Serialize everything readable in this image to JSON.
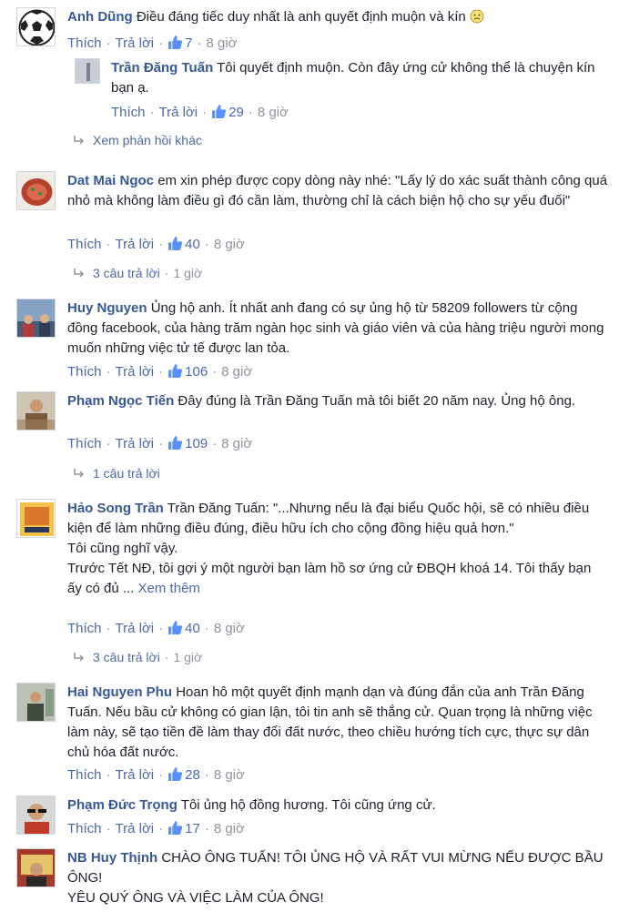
{
  "common": {
    "like_label": "Thích",
    "reply_label": "Trả lời",
    "sep": "·"
  },
  "comments": [
    {
      "name": "Anh Dũng",
      "text": "Điều đáng tiếc duy nhất là anh quyết định muộn và kín",
      "likes": "7",
      "time": "8 giờ",
      "avatar_color": "#222222",
      "reply": {
        "name": "Trần Đăng Tuấn",
        "text": "Tôi quyết định muộn. Còn đây ứng cử không thể là chuyện kín bạn ạ.",
        "likes": "29",
        "time": "8 giờ"
      },
      "more_replies": "Xem phản hồi khác"
    },
    {
      "name": "Dat Mai Ngoc",
      "text": "em xin phép được copy dòng này nhé: \"Lấy lý do xác suất thành công quá nhỏ mà không làm điều gì đó cần làm, thường chỉ là cách biện hộ cho sự yếu đuối\"",
      "likes": "40",
      "time": "8 giờ",
      "avatar_color": "#b5412f",
      "replies_count": "3 câu trả lời",
      "replies_time": "1 giờ"
    },
    {
      "name": "Huy Nguyen",
      "text": "Ủng hộ anh. Ít nhất anh đang có sự ủng hộ từ 58209 followers từ cộng đồng facebook, của hàng trăm ngàn học sinh và giáo viên và của hàng triệu người mong muốn những việc tử tế được lan tỏa.",
      "likes": "106",
      "time": "8 giờ",
      "avatar_color": "#6b7f9a"
    },
    {
      "name": "Phạm Ngọc Tiến",
      "text": "Đây đúng là Trần Đăng Tuấn mà tôi biết 20 năm nay. Ủng hộ ông.",
      "likes": "109",
      "time": "8 giờ",
      "avatar_color": "#8a6a4a",
      "replies_count": "1 câu trả lời"
    },
    {
      "name": "Hảo Song Trần",
      "text": "Trần Đăng Tuấn: \"...Nhưng nếu là đại biểu Quốc hội, sẽ có nhiều điều kiện để làm những điều đúng, điều hữu ích cho cộng đồng hiệu quả hơn.\"\nTôi cũng nghĩ vậy.\nTrước Tết NĐ, tôi gợi ý một người bạn làm hồ sơ ứng cử ĐBQH khoá 14. Tôi thấy bạn ấy có đủ ...",
      "see_more": "Xem thêm",
      "likes": "40",
      "time": "8 giờ",
      "avatar_color": "#d9772b",
      "replies_count": "3 câu trả lời",
      "replies_time": "1 giờ"
    },
    {
      "name": "Hai Nguyen Phu",
      "text": "Hoan hô một quyết định mạnh dạn và đúng đắn của anh Trần Đăng Tuấn. Nếu bầu cử không có gian lận, tôi tin anh sẽ thắng cử. Quan trọng là những việc làm này, sẽ tạo tiền đề làm thay đổi đất nước, theo chiều hướng tích cực, thực sự dân chủ hóa đất nước.",
      "likes": "28",
      "time": "8 giờ",
      "avatar_color": "#5a6b5a"
    },
    {
      "name": "Phạm Đức Trọng",
      "text": "Tôi ủng hộ đồng hương. Tôi cũng ứng cử.",
      "likes": "17",
      "time": "8 giờ",
      "avatar_color": "#3a3a3a"
    },
    {
      "name": "NB Huy Thịnh",
      "text": "CHÀO ÔNG TUẤN! TÔI ỦNG HỘ VÀ RẤT VUI MỪNG NẾU ĐƯỢC BẦU ÔNG!\nYÊU QUÝ ÔNG VÀ VIỆC LÀM CỦA ÔNG!",
      "avatar_color": "#a33a2a"
    }
  ]
}
